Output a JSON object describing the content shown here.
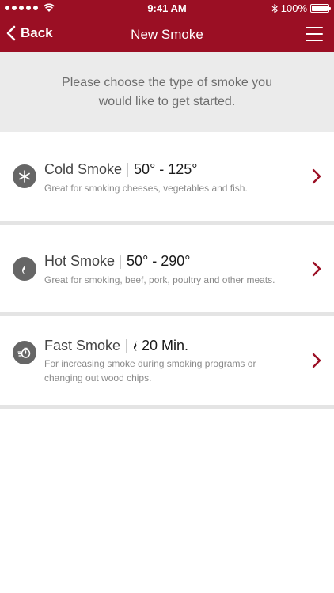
{
  "status_bar": {
    "time": "9:41 AM",
    "battery": "100%"
  },
  "nav": {
    "back_label": "Back",
    "title": "New Smoke"
  },
  "intro": {
    "text": "Please choose the type of smoke you would like to get started."
  },
  "options": [
    {
      "name": "Cold Smoke",
      "range": "50° - 125°",
      "description": "Great for smoking cheeses, vegetables and fish.",
      "icon": "snowflake-icon"
    },
    {
      "name": "Hot Smoke",
      "range": "50° - 290°",
      "description": "Great for smoking, beef, pork, poultry and other meats.",
      "icon": "flame-icon"
    },
    {
      "name": "Fast Smoke",
      "range": "20 Min.",
      "description": "For increasing smoke during smoking programs or changing out wood chips.",
      "icon": "fast-timer-icon"
    }
  ],
  "colors": {
    "brand": "#9b0f24",
    "intro_bg": "#ebebeb",
    "icon_bg": "#666666",
    "separator": "#e4e4e4"
  }
}
